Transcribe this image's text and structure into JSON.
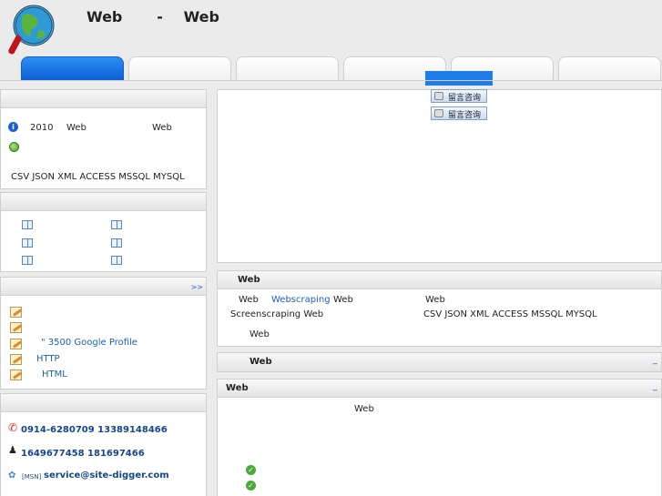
{
  "header": {
    "title": "Web     -   Web"
  },
  "consult_button_label": "留言咨询",
  "left": {
    "panel1": {
      "row1": [
        "2010",
        "Web",
        "Web"
      ],
      "row3": "CSV JSON XML ACCESS MSSQL MYSQL"
    },
    "panel3": {
      "more_label": ">>",
      "items": [
        "",
        "",
        "\"   3500  Google Profile",
        "HTTP",
        "HTML"
      ]
    },
    "contact": {
      "phones": "0914-6280709    13389148466",
      "qq": "1649677458    181697466",
      "msn_tag": "[MSN]",
      "msn": "service@site-digger.com"
    }
  },
  "right": {
    "web_panel": {
      "title": "Web",
      "line1_a": "Web",
      "line1_link": "Webscraping",
      "line1_b": "Web",
      "line1_c": "Web",
      "line2_a": "Screenscraping  Web",
      "line2_b": "CSV JSON XML ACCESS MSSQL MYSQL",
      "line3": "Web"
    },
    "bar1": {
      "title": "Web",
      "dash": "_"
    },
    "bar2": {
      "title": "Web",
      "dash": "_",
      "body_text": "Web"
    }
  },
  "colors": {
    "accent_blue": "#1e7de8",
    "link_blue": "#1a5fc2",
    "check_green": "#4ca93a"
  }
}
